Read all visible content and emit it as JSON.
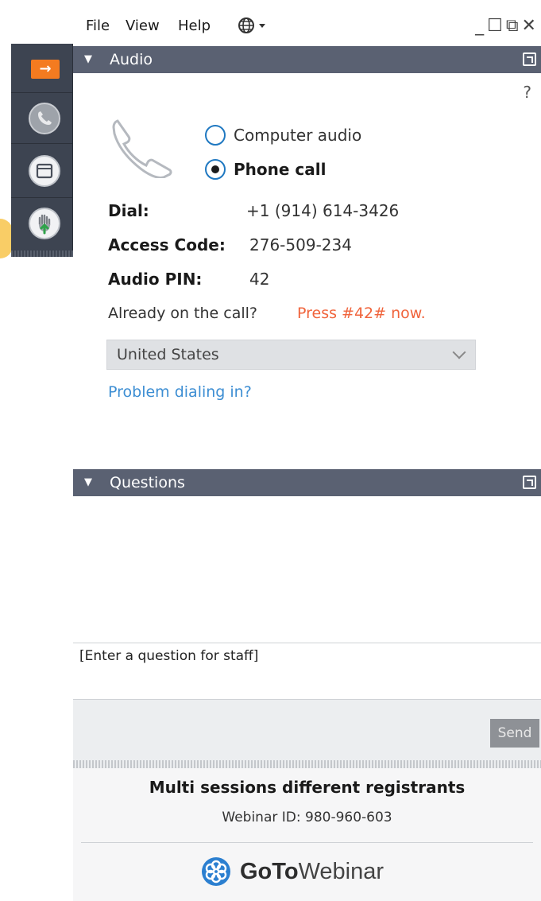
{
  "menu": {
    "file": "File",
    "view": "View",
    "help": "Help",
    "language_icon": "globe-icon",
    "window_controls": "_☐⧉✕"
  },
  "toolbar": {
    "items": [
      "arrow-right-icon",
      "phone-icon",
      "screen-icon",
      "raise-hand-icon"
    ],
    "accent_color": "#f47b20",
    "background_color": "#3d4451"
  },
  "audio_panel": {
    "title": "Audio",
    "help": "?",
    "options": {
      "computer_audio": "Computer audio",
      "phone_call": "Phone call",
      "selected": "phone_call"
    },
    "dial_label": "Dial:",
    "dial_value": "+1 (914) 614-3426",
    "access_code_label": "Access Code:",
    "access_code_value": "276-509-234",
    "audio_pin_label": "Audio PIN:",
    "audio_pin_value": "42",
    "already_text": "Already on the call?",
    "press_text": "Press #42# now.",
    "country": "United States",
    "problem_link": "Problem dialing in?"
  },
  "questions_panel": {
    "title": "Questions",
    "input_placeholder": "[Enter a question for staff]",
    "send_label": "Send"
  },
  "footer": {
    "session_title": "Multi sessions different registrants",
    "webinar_id": "Webinar ID: 980-960-603",
    "brand_bold": "GoTo",
    "brand_light": "Webinar"
  },
  "colors": {
    "panel_header": "#5a6172",
    "link": "#3d8ed3",
    "press_highlight": "#f0643c",
    "radio_border": "#1f78c1"
  }
}
